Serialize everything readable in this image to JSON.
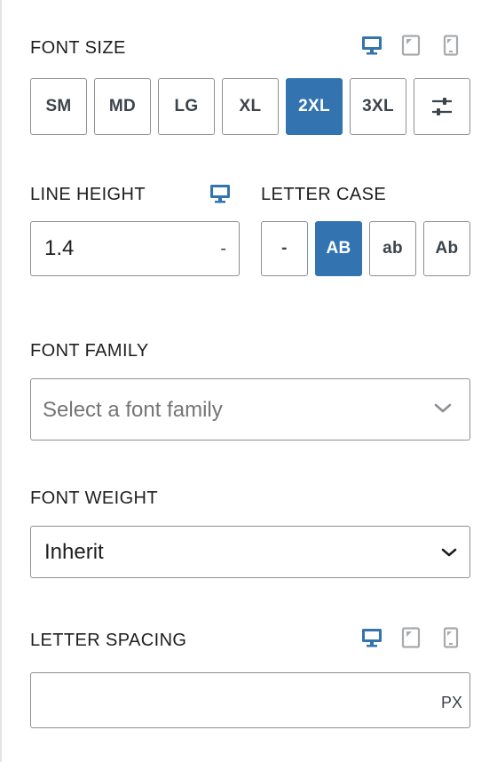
{
  "font_size": {
    "label": "FONT SIZE",
    "devices": [
      "desktop-icon",
      "tablet-icon",
      "mobile-icon"
    ],
    "active_device": "desktop",
    "options": [
      "SM",
      "MD",
      "LG",
      "XL",
      "2XL",
      "3XL"
    ],
    "selected": "2XL",
    "custom_icon": "sliders-icon"
  },
  "line_height": {
    "label": "LINE HEIGHT",
    "device": "desktop-icon",
    "value": "1.4",
    "unit": "-"
  },
  "letter_case": {
    "label": "LETTER CASE",
    "options": [
      "-",
      "AB",
      "ab",
      "Ab"
    ],
    "selected": "AB"
  },
  "font_family": {
    "label": "FONT FAMILY",
    "placeholder": "Select a font family",
    "icon": "chevron-down-icon"
  },
  "font_weight": {
    "label": "FONT WEIGHT",
    "value": "Inherit",
    "icon": "chevron-down-icon"
  },
  "letter_spacing": {
    "label": "LETTER SPACING",
    "devices": [
      "desktop-icon",
      "tablet-icon",
      "mobile-icon"
    ],
    "active_device": "desktop",
    "value": "",
    "unit": "PX"
  },
  "colors": {
    "accent": "#3273b0",
    "border": "#8c8f94",
    "muted_icon": "#a7aaad",
    "text": "#1e1e1e"
  }
}
